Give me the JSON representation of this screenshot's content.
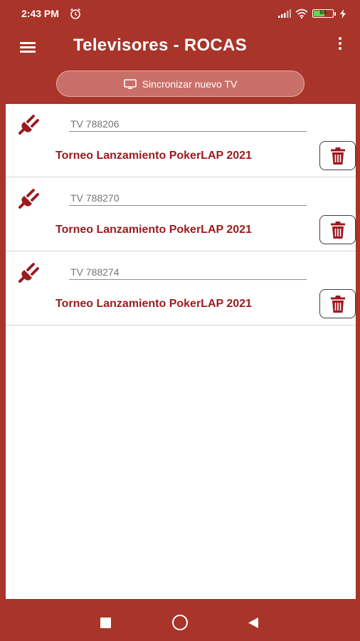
{
  "status_bar": {
    "time": "2:43 PM",
    "battery_level": "60",
    "battery_fraction": 0.6,
    "icons": [
      "alarm-icon",
      "signal-icon",
      "wifi-icon",
      "battery-icon",
      "charging-icon"
    ]
  },
  "app_bar": {
    "title": "Televisores - ROCAS",
    "icons": [
      "hamburger-menu-icon",
      "overflow-menu-icon"
    ]
  },
  "sync_button": {
    "label": "Sincronizar nuevo TV",
    "icon": "tv-icon"
  },
  "tv_list": [
    {
      "tv_id": "TV 788206",
      "tournament": "Torneo Lanzamiento PokerLAP 2021",
      "icons": [
        "plug-icon",
        "trash-icon"
      ]
    },
    {
      "tv_id": "TV 788270",
      "tournament": "Torneo Lanzamiento PokerLAP 2021",
      "icons": [
        "plug-icon",
        "trash-icon"
      ]
    },
    {
      "tv_id": "TV 788274",
      "tournament": "Torneo Lanzamiento PokerLAP 2021",
      "icons": [
        "plug-icon",
        "trash-icon"
      ]
    }
  ],
  "nav_bar": {
    "icons": [
      "recents-icon",
      "home-icon",
      "back-icon"
    ]
  },
  "colors": {
    "primary": "#a8342a",
    "accent_text": "#9b1a1f",
    "button_fill": "#c96f69",
    "surface": "#ffffff"
  }
}
